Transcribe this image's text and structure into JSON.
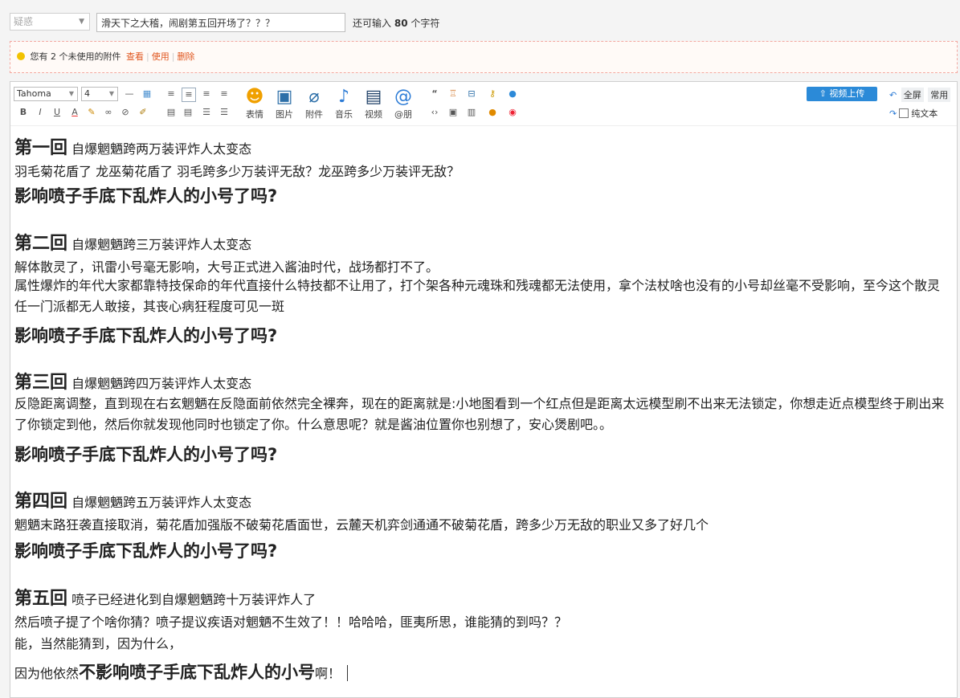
{
  "form": {
    "type_select": "疑惑",
    "title_value": "滑天下之大稽，闹剧第五回开场了？？？",
    "char_count_prefix": "还可输入",
    "char_count_number": "80",
    "char_count_suffix": "个字符"
  },
  "notice": {
    "text": "您有 2 个未使用的附件",
    "view": "查看",
    "use": "使用",
    "delete": "删除"
  },
  "toolbar": {
    "font": "Tahoma",
    "size": "4",
    "emoji_label": "表情",
    "image_label": "图片",
    "attach_label": "附件",
    "music_label": "音乐",
    "video_label": "视频",
    "mention_label": "@朋",
    "video_upload": "视频上传",
    "fullscreen": "全屏",
    "common": "常用",
    "plain_text": "纯文本"
  },
  "content": {
    "ch1_title": "第一回",
    "ch1_sub": "自爆魍魉跨两万装评炸人太变态",
    "ch1_p1": "羽毛菊花盾了 龙巫菊花盾了   羽毛跨多少万装评无敌？龙巫跨多少万装评无敌？",
    "ch1_bold": "影响喷子手底下乱炸人的小号了吗?",
    "ch2_title": "第二回",
    "ch2_sub": "自爆魍魉跨三万装评炸人太变态",
    "ch2_p1": "解体散灵了，讯雷小号毫无影响，大号正式进入酱油时代，战场都打不了。",
    "ch2_p2": "属性爆炸的年代大家都靠特技保命的年代直接什么特技都不让用了，打个架各种元魂珠和残魂都无法使用，拿个法杖啥也没有的小号却丝毫不受影响，至今这个散灵任一门派都无人敢接，其丧心病狂程度可见一斑",
    "ch2_bold": "影响喷子手底下乱炸人的小号了吗?",
    "ch3_title": "第三回",
    "ch3_sub": "自爆魍魉跨四万装评炸人太变态",
    "ch3_p1": "反隐距离调整，直到现在右玄魍魉在反隐面前依然完全裸奔，现在的距离就是:小地图看到一个红点但是距离太远模型刷不出来无法锁定，你想走近点模型终于刷出来了你锁定到他，然后你就发现他同时也锁定了你。什么意思呢？就是酱油位置你也别想了，安心煲剧吧。。",
    "ch3_bold": "影响喷子手底下乱炸人的小号了吗?",
    "ch4_title": "第四回",
    "ch4_sub": "自爆魍魉跨五万装评炸人太变态",
    "ch4_p1": "魍魉末路狂袭直接取消，菊花盾加强版不破菊花盾面世，云麓天机弈剑通通不破菊花盾，跨多少万无敌的职业又多了好几个",
    "ch4_bold": "影响喷子手底下乱炸人的小号了吗?",
    "ch5_title": "第五回",
    "ch5_sub": "喷子已经进化到自爆魍魉跨十万装评炸人了",
    "ch5_p1": "然后喷子提了个啥你猜？喷子提议疾语对魍魉不生效了！！哈哈哈，匪夷所思，谁能猜的到吗？？",
    "ch5_p2": "能，当然能猜到，因为什么，",
    "ch5_p3_pre": "因为他依然",
    "ch5_p3_bold": "不影响喷子手底下乱炸人的小号",
    "ch5_p3_post": "啊！"
  }
}
